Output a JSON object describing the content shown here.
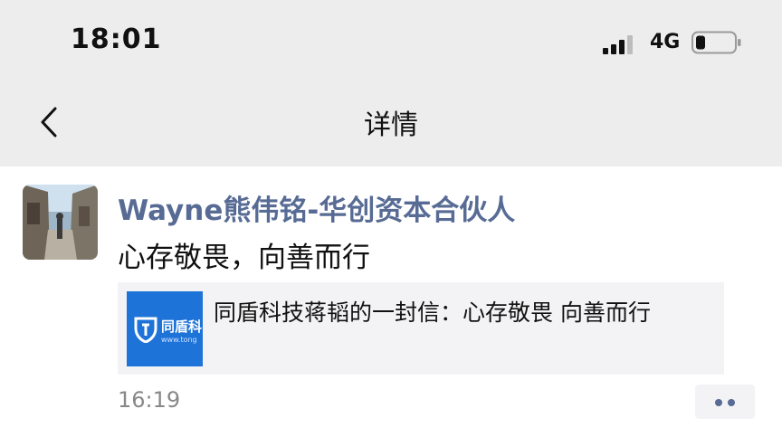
{
  "status_bar": {
    "time": "18:01",
    "network": "4G",
    "icons": [
      "signal-icon",
      "battery-icon"
    ]
  },
  "nav": {
    "title": "详情",
    "back_icon": "chevron-left-icon"
  },
  "post": {
    "author": "Wayne熊伟铭-华创资本合伙人",
    "text": "心存敬畏，向善而行",
    "link": {
      "thumbnail_text": "同盾科",
      "thumbnail_url_text": "www.tong",
      "title": "同盾科技蒋韬的一封信：心存敬畏 向善而行"
    },
    "time": "16:19",
    "more_icon": "more-dots-icon"
  },
  "colors": {
    "header_bg": "#ededed",
    "name_link": "#576b95",
    "card_bg": "#f3f3f5",
    "thumb_blue": "#1e73d8"
  }
}
